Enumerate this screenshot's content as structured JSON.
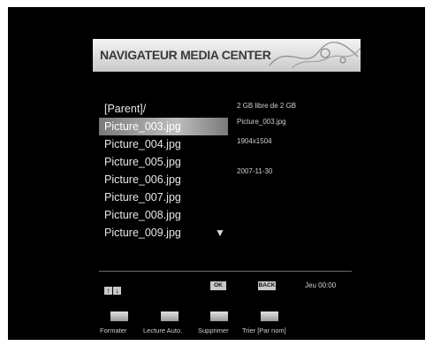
{
  "header": {
    "title": "NAVIGATEUR MEDIA CENTER"
  },
  "file_list": {
    "items": [
      {
        "label": "[Parent]/",
        "selected": false
      },
      {
        "label": "Picture_003.jpg",
        "selected": true
      },
      {
        "label": "Picture_004.jpg",
        "selected": false
      },
      {
        "label": "Picture_005.jpg",
        "selected": false
      },
      {
        "label": "Picture_006.jpg",
        "selected": false
      },
      {
        "label": "Picture_007.jpg",
        "selected": false
      },
      {
        "label": "Picture_008.jpg",
        "selected": false
      },
      {
        "label": "Picture_009.jpg",
        "selected": false
      }
    ],
    "more_indicator_icon": "chevron-down-icon"
  },
  "info_panel": {
    "storage": "2 GB libre de 2 GB",
    "filename": "Picture_003.jpg",
    "resolution": "1904x1504",
    "date": "2007-11-30"
  },
  "status_bar": {
    "nav_icons": [
      "arrow-up-icon",
      "arrow-down-icon"
    ],
    "ok_key": "OK",
    "back_key": "BACK",
    "clock": "Jeu 00:00"
  },
  "function_keys": [
    {
      "label": "Formater"
    },
    {
      "label": "Lecture Auto."
    },
    {
      "label": "Supprimer"
    },
    {
      "label": "Trier [Par nom]"
    }
  ],
  "colors": {
    "background": "#000000",
    "title_bar": "#d9d9d9",
    "text": "#e6e6e6",
    "selected_row": "#9e9e9e"
  }
}
